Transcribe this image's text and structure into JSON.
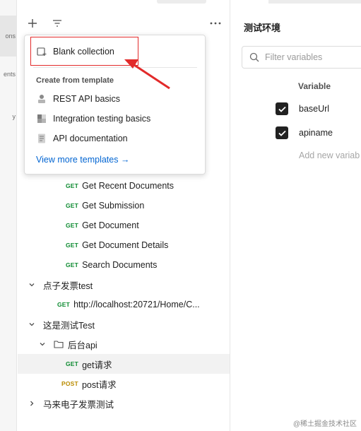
{
  "rail": {
    "items": [
      {
        "label": "ons",
        "active": true
      },
      {
        "label": "ents",
        "active": false
      },
      {
        "label": "y",
        "active": false
      }
    ]
  },
  "sidebar": {
    "new_icon": "plus-icon",
    "filter_icon": "filter-icon",
    "more_icon": "more-icon",
    "tree": [
      {
        "method": "GET",
        "label": "Get Recent Documents",
        "indent": 2
      },
      {
        "method": "GET",
        "label": "Get Submission",
        "indent": 2
      },
      {
        "method": "GET",
        "label": "Get Document",
        "indent": 2
      },
      {
        "method": "GET",
        "label": "Get Document Details",
        "indent": 2
      },
      {
        "method": "GET",
        "label": "Search Documents",
        "indent": 2
      },
      {
        "type": "collection",
        "expanded": true,
        "label": "点子发票test"
      },
      {
        "method": "GET",
        "label": "http://localhost:20721/Home/C...",
        "indent": 1
      },
      {
        "type": "collection",
        "expanded": true,
        "label": "这是测试Test"
      },
      {
        "type": "folder",
        "expanded": true,
        "label": "后台api"
      },
      {
        "method": "GET",
        "label": "get请求",
        "indent": 2,
        "selected": true
      },
      {
        "method": "POST",
        "label": "post请求",
        "indent": 2
      },
      {
        "type": "collection",
        "expanded": false,
        "label": "马来电子发票测试"
      }
    ]
  },
  "menu": {
    "blank_collection": "Blank collection",
    "template_heading": "Create from template",
    "templates": [
      {
        "label": "REST API basics",
        "icon": "rest-api-icon"
      },
      {
        "label": "Integration testing basics",
        "icon": "integration-testing-icon"
      },
      {
        "label": "API documentation",
        "icon": "documentation-icon"
      }
    ],
    "view_more": "View more templates →"
  },
  "environment": {
    "title": "测试环境",
    "search_placeholder": "Filter variables",
    "column_variable": "Variable",
    "variables": [
      {
        "name": "baseUrl",
        "checked": true
      },
      {
        "name": "apiname",
        "checked": true
      }
    ],
    "add_placeholder": "Add new variab"
  },
  "colors": {
    "get": "#0b8a2f",
    "post": "#b98b00",
    "link": "#0265d2",
    "annotation": "#e22a2a"
  },
  "watermark": "@稀土掘金技术社区"
}
